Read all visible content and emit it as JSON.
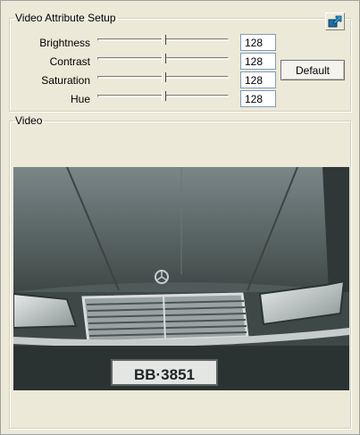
{
  "attribute_setup": {
    "legend": "Video Attribute Setup",
    "corner_button_icon": "export-arrow-icon",
    "rows": [
      {
        "label": "Brightness",
        "value": "128",
        "level": 0.5
      },
      {
        "label": "Contrast",
        "value": "128",
        "level": 0.5
      },
      {
        "label": "Saturation",
        "value": "128",
        "level": 0.5
      },
      {
        "label": "Hue",
        "value": "128",
        "level": 0.5
      }
    ],
    "default_label": "Default"
  },
  "video": {
    "legend": "Video",
    "plate_text": "BB·3851"
  }
}
